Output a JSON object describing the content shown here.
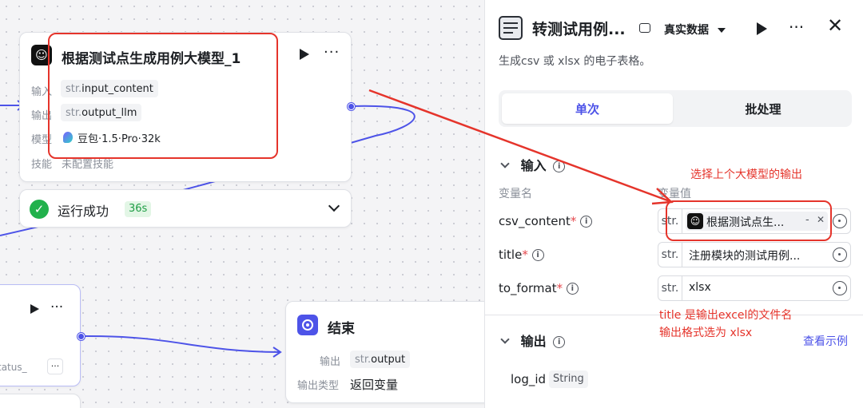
{
  "llm_node": {
    "title": "根据测试点生成用例大模型_1",
    "rows": [
      {
        "label": "输入",
        "prefix": "str.",
        "value": "input_content"
      },
      {
        "label": "输出",
        "prefix": "str.",
        "value": "output_llm"
      }
    ],
    "model_label": "模型",
    "model_value": "豆包·1.5·Pro·32k",
    "skill_label": "技能",
    "skill_value": "未配置技能"
  },
  "run_status": {
    "text": "运行成功",
    "duration": "36s"
  },
  "partial_node": {
    "tag_text": "tatus_",
    "more": "···"
  },
  "end_node": {
    "title": "结束",
    "output_label": "输出",
    "output_prefix": "str.",
    "output_value": "output",
    "type_label": "输出类型",
    "type_value": "返回变量"
  },
  "panel": {
    "title": "转测试用例...",
    "data_select": "真实数据",
    "description": "生成csv 或 xlsx 的电子表格。",
    "tabs": [
      "单次",
      "批处理"
    ],
    "input_section": "输入",
    "col_name": "变量名",
    "col_value": "变量值",
    "inputs": [
      {
        "name": "csv_content",
        "prefix": "str.",
        "value": "根据测试点生...",
        "ref_suffix": "-",
        "is_ref": true
      },
      {
        "name": "title",
        "prefix": "str.",
        "value": "注册模块的测试用例...",
        "is_ref": false
      },
      {
        "name": "to_format",
        "prefix": "str.",
        "value": "xlsx",
        "is_ref": false
      }
    ],
    "output_section": "输出",
    "view_example": "查看示例",
    "output_var": "log_id",
    "output_type": "String"
  },
  "annotations": {
    "note1": "选择上个大模型的输出",
    "note2_line1": "title 是输出excel的文件名",
    "note2_line2": "输出格式选为 xlsx"
  },
  "colors": {
    "accent": "#4d53e8",
    "annotation": "#e5342b",
    "success": "#22b14c"
  }
}
